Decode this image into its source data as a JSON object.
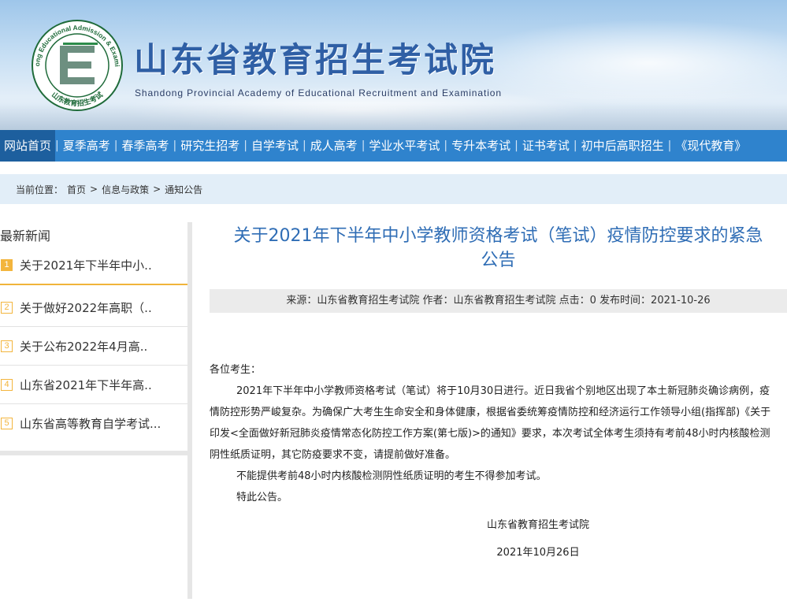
{
  "header": {
    "logo_ring_text": "Shandong Educational Admission & Examination",
    "logo_bottom_text": "山东教育招生考试",
    "title": "山东省教育招生考试院",
    "subtitle": "Shandong Provincial Academy of Educational Recruitment and Examination"
  },
  "nav": {
    "items": [
      "网站首页",
      "夏季高考",
      "春季高考",
      "研究生招考",
      "自学考试",
      "成人高考",
      "学业水平考试",
      "专升本考试",
      "证书考试",
      "初中后高职招生",
      "《现代教育》"
    ],
    "separator": "|",
    "active_index": 0
  },
  "breadcrumb": {
    "label": "当前位置：",
    "items": [
      "首页",
      "信息与政策",
      "通知公告"
    ],
    "separator": ">"
  },
  "sidebar": {
    "title": "最新新闻",
    "items": [
      {
        "num": "1",
        "text": "关于2021年下半年中小.."
      },
      {
        "num": "2",
        "text": "关于做好2022年高职（.."
      },
      {
        "num": "3",
        "text": "关于公布2022年4月高.."
      },
      {
        "num": "4",
        "text": "山东省2021年下半年高.."
      },
      {
        "num": "5",
        "text": "山东省高等教育自学考试..."
      }
    ]
  },
  "article": {
    "title_line1": "关于2021年下半年中小学教师资格考试（笔试）疫情防控要求的紧急",
    "title_line2": "公告",
    "meta": "来源：山东省教育招生考试院 作者：山东省教育招生考试院 点击：0 发布时间：2021-10-26",
    "salutation": "各位考生：",
    "paragraph1": "2021年下半年中小学教师资格考试（笔试）将于10月30日进行。近日我省个别地区出现了本土新冠肺炎确诊病例，疫情防控形势严峻复杂。为确保广大考生生命安全和身体健康，根据省委统筹疫情防控和经济运行工作领导小组(指挥部)《关于印发<全面做好新冠肺炎疫情常态化防控工作方案(第七版)>的通知》要求，本次考试全体考生须持有考前48小时内核酸检测阴性纸质证明，其它防疫要求不变，请提前做好准备。",
    "paragraph2": "不能提供考前48小时内核酸检测阴性纸质证明的考生不得参加考试。",
    "paragraph3": "特此公告。",
    "signature": "山东省教育招生考试院",
    "date": "2021年10月26日"
  },
  "colors": {
    "nav_bg": "#2f83cd",
    "nav_active": "#1d5f9e",
    "title_blue": "#2f6db5",
    "accent_orange": "#f3b53d",
    "breadcrumb_bg": "#e2eef8"
  }
}
